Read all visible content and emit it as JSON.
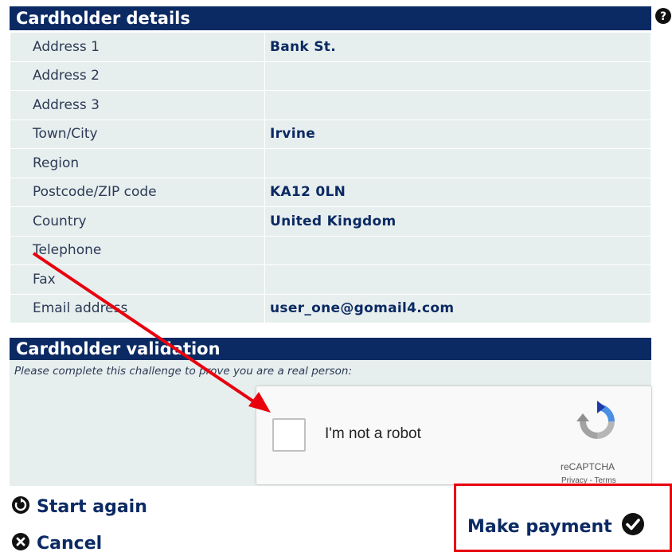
{
  "details": {
    "title": "Cardholder details",
    "rows": [
      {
        "label": "Address 1",
        "value": "Bank St."
      },
      {
        "label": "Address 2",
        "value": ""
      },
      {
        "label": "Address 3",
        "value": ""
      },
      {
        "label": "Town/City",
        "value": "Irvine"
      },
      {
        "label": "Region",
        "value": ""
      },
      {
        "label": "Postcode/ZIP code",
        "value": "KA12 0LN"
      },
      {
        "label": "Country",
        "value": "United Kingdom"
      },
      {
        "label": "Telephone",
        "value": ""
      },
      {
        "label": "Fax",
        "value": ""
      },
      {
        "label": "Email address",
        "value": "user_one@gomail4.com"
      }
    ]
  },
  "validation": {
    "title": "Cardholder validation",
    "hint": "Please complete this challenge to prove you are a real person:",
    "recaptcha": {
      "label": "I'm not a robot",
      "brand": "reCAPTCHA",
      "links": "Privacy - Terms",
      "checked": false
    }
  },
  "actions": {
    "start_again": "Start again",
    "cancel": "Cancel",
    "make_payment": "Make payment"
  },
  "annotation": {
    "arrow_color": "#e8000d",
    "highlight_color": "#e8000d"
  },
  "colors": {
    "header_bg": "#0b2a63",
    "row_bg": "#e7eeee",
    "text": "#0b2a63"
  }
}
